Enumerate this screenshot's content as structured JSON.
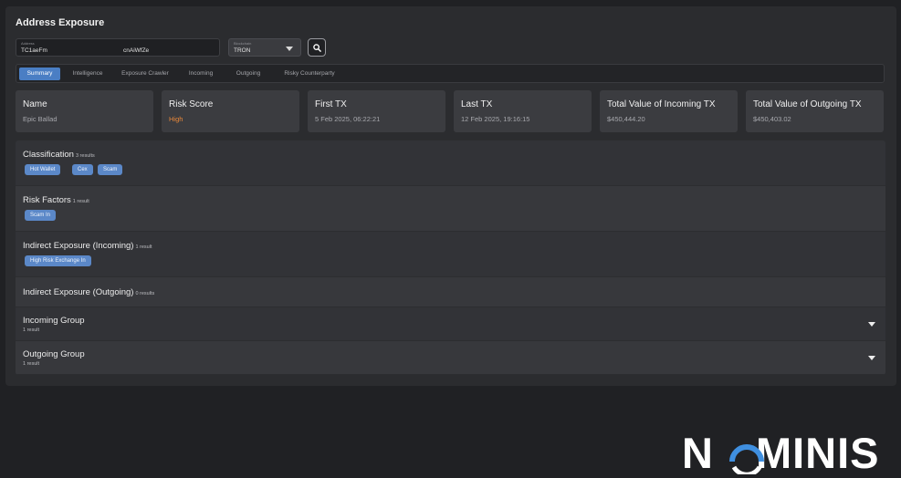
{
  "page": {
    "title": "Address Exposure"
  },
  "search": {
    "address_label": "Address",
    "address_value_left": "TC1aeFm",
    "address_value_right": "cnAiWfZe",
    "chain_label": "Blockchain",
    "chain_value": "TRON"
  },
  "tabs": [
    {
      "label": "Summary"
    },
    {
      "label": "Intelligence"
    },
    {
      "label": "Exposure Crawler"
    },
    {
      "label": "Incoming"
    },
    {
      "label": "Outgoing"
    },
    {
      "label": "Risky Counterparty"
    }
  ],
  "cards": [
    {
      "label": "Name",
      "value": "Epic Ballad"
    },
    {
      "label": "Risk Score",
      "value": "High"
    },
    {
      "label": "First TX",
      "value": "5 Feb 2025, 06:22:21"
    },
    {
      "label": "Last TX",
      "value": "12 Feb 2025, 19:16:15"
    },
    {
      "label": "Total Value of Incoming TX",
      "value": "$450,444.20"
    },
    {
      "label": "Total Value of Outgoing TX",
      "value": "$450,403.02"
    }
  ],
  "sections": {
    "classification": {
      "title": "Classification",
      "count": "3 results",
      "chips": [
        "Hot Wallet",
        "Cex",
        "Scam"
      ]
    },
    "risk_factors": {
      "title": "Risk Factors",
      "count": "1 result",
      "chips": [
        "Scam In"
      ]
    },
    "indirect_incoming": {
      "title": "Indirect Exposure (Incoming)",
      "count": "1 result",
      "chips": [
        "High Risk Exchange In"
      ]
    },
    "indirect_outgoing": {
      "title": "Indirect Exposure (Outgoing)",
      "count": "0 results"
    },
    "incoming_group": {
      "title": "Incoming Group",
      "count": "1 result"
    },
    "outgoing_group": {
      "title": "Outgoing Group",
      "count": "1 result"
    }
  },
  "logo": {
    "text_first": "N",
    "text_rest": "MINIS",
    "full": "NOMINIS"
  },
  "colors": {
    "accent": "#4a7ec4",
    "chip": "#5b88c8",
    "risk_high": "#e8883a",
    "logo_arc": "#3f8fe0"
  },
  "icons": {
    "search": "search-icon",
    "dropdown": "chevron-down-icon",
    "expand": "caret-down-icon"
  }
}
